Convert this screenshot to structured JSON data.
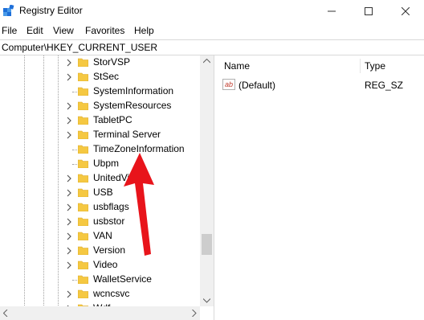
{
  "window": {
    "title": "Registry Editor"
  },
  "titlebar_buttons": [
    "minimize-icon",
    "maximize-icon",
    "close-icon"
  ],
  "menu": [
    "File",
    "Edit",
    "View",
    "Favorites",
    "Help"
  ],
  "address": "Computer\\HKEY_CURRENT_USER",
  "tree": {
    "items": [
      {
        "label": "StorVSP",
        "expandable": true
      },
      {
        "label": "StSec",
        "expandable": true
      },
      {
        "label": "SystemInformation",
        "expandable": false
      },
      {
        "label": "SystemResources",
        "expandable": true
      },
      {
        "label": "TabletPC",
        "expandable": true
      },
      {
        "label": "Terminal Server",
        "expandable": true
      },
      {
        "label": "TimeZoneInformation",
        "expandable": false
      },
      {
        "label": "Ubpm",
        "expandable": false
      },
      {
        "label": "UnitedVid",
        "expandable": true
      },
      {
        "label": "USB",
        "expandable": true
      },
      {
        "label": "usbflags",
        "expandable": true
      },
      {
        "label": "usbstor",
        "expandable": true
      },
      {
        "label": "VAN",
        "expandable": true
      },
      {
        "label": "Version",
        "expandable": true
      },
      {
        "label": "Video",
        "expandable": true
      },
      {
        "label": "WalletService",
        "expandable": false
      },
      {
        "label": "wcncsvc",
        "expandable": true
      },
      {
        "label": "Wdf",
        "expandable": true
      }
    ]
  },
  "values_pane": {
    "columns": [
      "Name",
      "Type"
    ],
    "rows": [
      {
        "name": "(Default)",
        "type": "REG_SZ",
        "icon": "ab-string-icon",
        "icon_text": "ab"
      }
    ]
  },
  "colors": {
    "folder": "#f5c842",
    "arrow": "#e8141b",
    "icon_blue": "#1e6fd9"
  }
}
